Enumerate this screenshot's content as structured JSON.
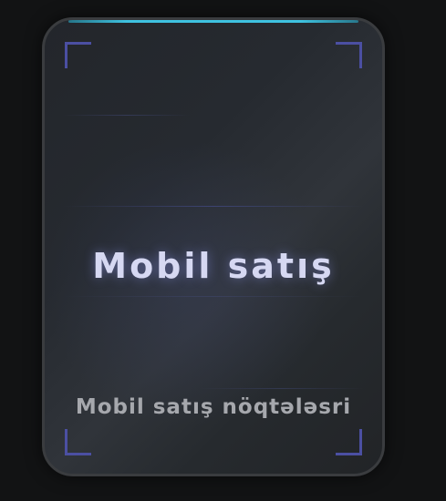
{
  "card": {
    "title": "Mobil satış",
    "subtitle": "Mobil satış nöqtələsri"
  },
  "colors": {
    "page_background": "#121314",
    "card_border": "#3a3c3f",
    "top_accent": "#3ec2e0",
    "corner_brackets": "#4b4fa2",
    "title_text": "#d6d8f2",
    "subtitle_text": "#a6a8ad"
  }
}
